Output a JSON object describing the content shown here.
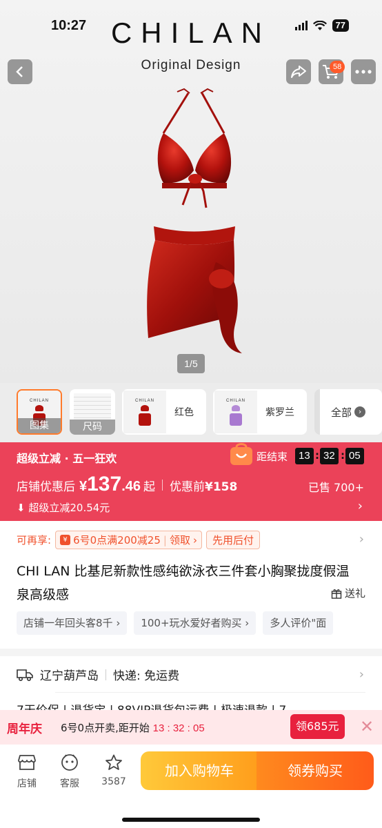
{
  "status": {
    "time": "10:27",
    "battery": "77"
  },
  "brand": {
    "name": "CHILAN",
    "subtitle": "Original Design"
  },
  "header": {
    "cart_count": "58"
  },
  "gallery": {
    "page_indicator": "1/5"
  },
  "thumbnails": [
    {
      "label": "图集"
    },
    {
      "label": "尺码"
    },
    {
      "label": "红色"
    },
    {
      "label": "紫罗兰"
    },
    {
      "label": "全部"
    }
  ],
  "promo": {
    "title": "超级立减 · 五一狂欢",
    "countdown_label": "距结束",
    "countdown": [
      "13",
      "32",
      "05"
    ],
    "price_label": "店铺优惠后",
    "currency": "¥",
    "price_int": "137",
    "price_dec": ".46",
    "price_suffix": "起",
    "original_label": "优惠前",
    "original_price": "¥158",
    "sold": "已售 700+",
    "sub": "超级立减20.54元"
  },
  "info": {
    "coupon_lead": "可再享:",
    "coupon_text": "6号0点满200减25",
    "coupon_claim": "领取",
    "pay_later": "先用后付",
    "title": "CHI LAN 比基尼新款性感纯欲泳衣三件套小胸聚拢度假温泉高级感",
    "gift": "送礼",
    "tags": [
      "店铺一年回头客8千",
      "100+玩水爱好者购买",
      "多人评价\"面"
    ]
  },
  "shipping": {
    "origin": "辽宁葫芦岛",
    "delivery": "快递: 免运费",
    "row2": "7天价保 | 退货宝 | 88VIP退货包运费 | 极速退款 | 7"
  },
  "anniversary": {
    "title": "周年庆",
    "text": "6号0点开卖,距开始",
    "time": "13 : 32 : 05",
    "button": "领685元"
  },
  "bottom_bar": {
    "store": "店铺",
    "service": "客服",
    "favorites": "3587",
    "add_to_cart": "加入购物车",
    "buy": "领券购买"
  },
  "colors": {
    "accent": "#eb4259",
    "orange": "#ff5b1a",
    "yellow": "#ffc93a"
  }
}
